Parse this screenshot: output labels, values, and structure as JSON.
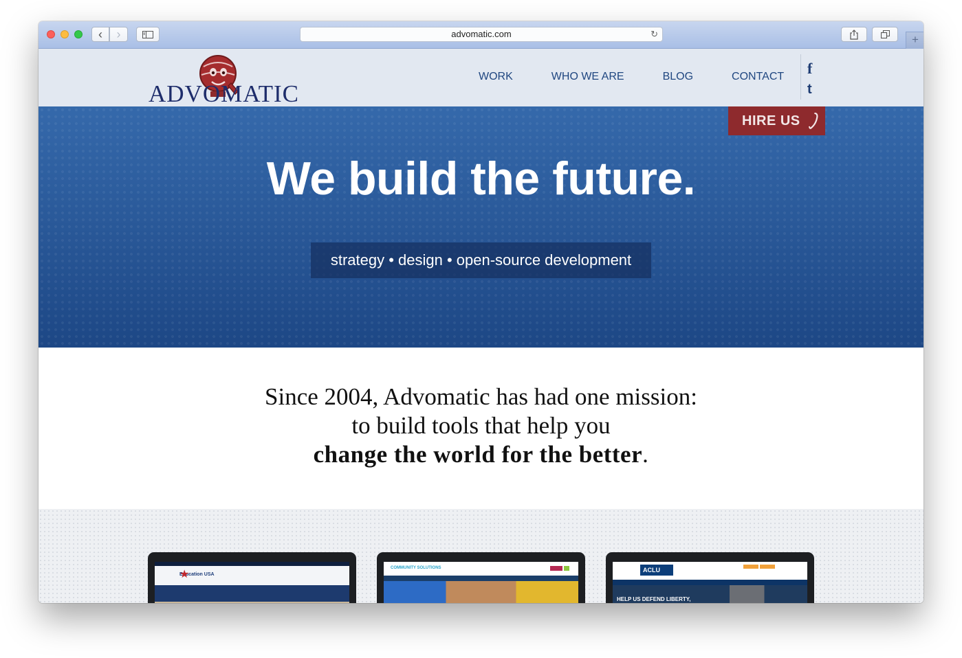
{
  "browser": {
    "url": "advomatic.com",
    "back_label": "‹",
    "forward_label": "›",
    "new_tab_label": "+"
  },
  "site": {
    "logo_text": "ADVOMATIC",
    "nav": [
      "WORK",
      "WHO WE ARE",
      "BLOG",
      "CONTACT"
    ],
    "social": {
      "facebook": "f",
      "twitter": "t"
    },
    "hire_us": "HIRE US"
  },
  "hero": {
    "title": "We build the future.",
    "tagline": "strategy • design • open-source development"
  },
  "mission": {
    "line1": "Since 2004, Advomatic has had one mission:",
    "line2": "to build tools that help you",
    "line3_bold": "change the world for the better",
    "line3_end": "."
  },
  "portfolio": [
    {
      "name": "Education USA",
      "heading": "Education USA"
    },
    {
      "name": "Community Solutions",
      "heading": "COMMUNITY SOLUTIONS"
    },
    {
      "name": "ACLU",
      "heading": "ACLU",
      "banner": "HELP US DEFEND LIBERTY,"
    }
  ],
  "colors": {
    "nav_text": "#1f4680",
    "hero_blue": "#275a9c",
    "hire_red": "#8e2a2d",
    "logo_red": "#9b2a2c"
  }
}
